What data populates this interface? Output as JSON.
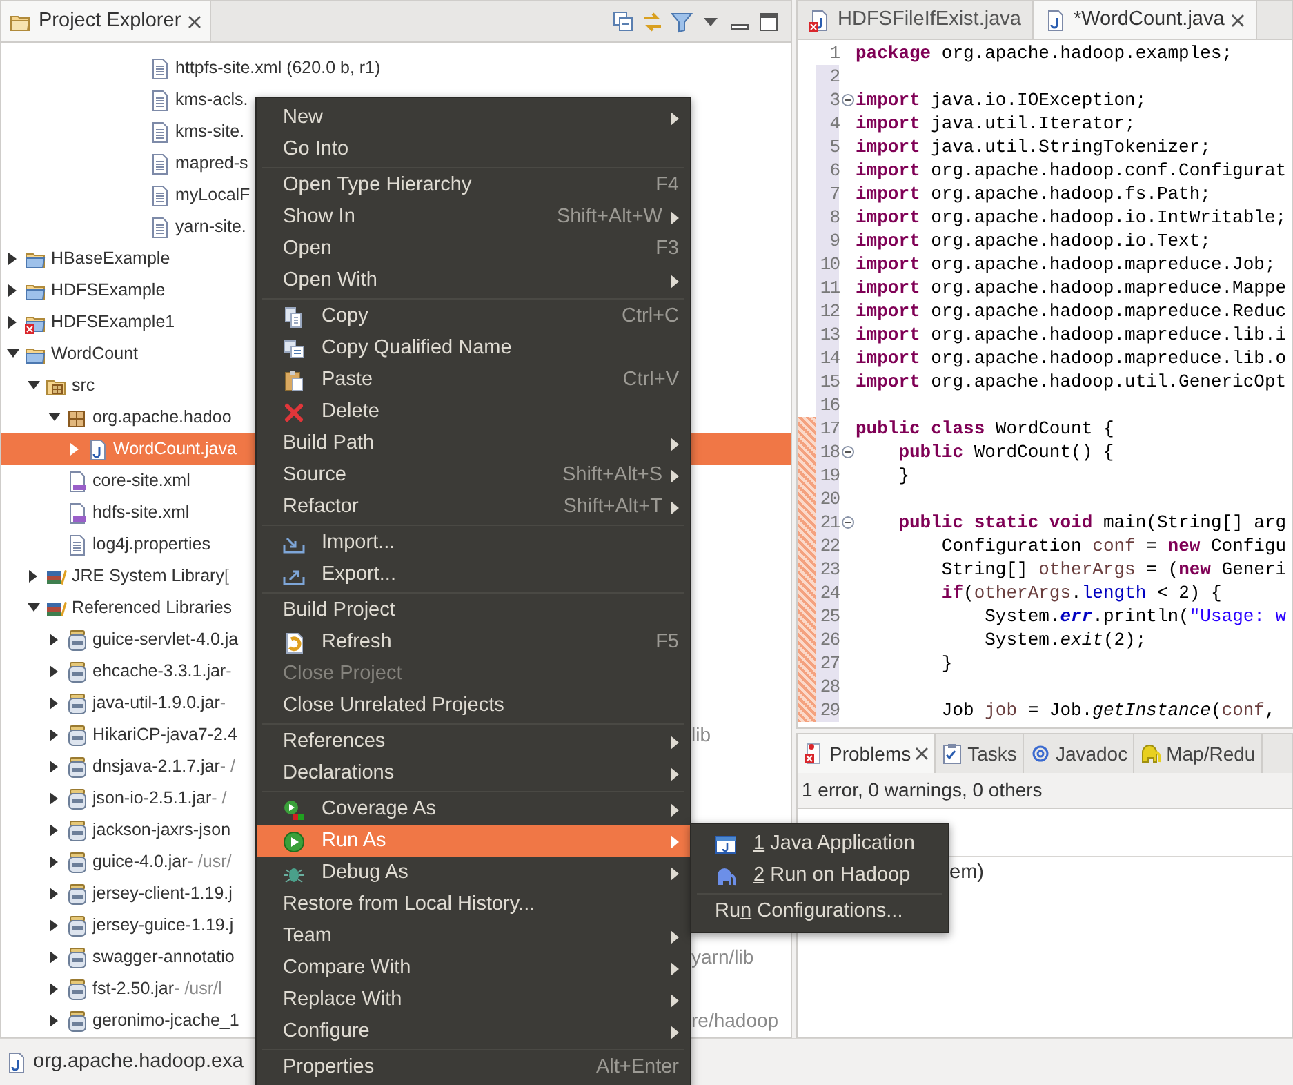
{
  "explorer": {
    "title": "Project Explorer",
    "scrolled_children": [
      {
        "label": "httpfs-site.xml (620.0 b, r1)",
        "kind": "file",
        "selected": false
      },
      {
        "label": "kms-acls.",
        "kind": "file",
        "selected": false
      },
      {
        "label": "kms-site.",
        "kind": "file",
        "selected": false
      },
      {
        "label": "mapred-s",
        "kind": "file",
        "selected": false
      },
      {
        "label": "myLocalF",
        "kind": "file",
        "selected": false
      },
      {
        "label": "yarn-site.",
        "kind": "file",
        "selected": false
      }
    ],
    "items": [
      {
        "label": "HBaseExample",
        "kind": "project",
        "expanded": false,
        "selected": false
      },
      {
        "label": "HDFSExample",
        "kind": "project",
        "expanded": false,
        "selected": false
      },
      {
        "label": "HDFSExample1",
        "kind": "project-error",
        "expanded": false,
        "selected": false
      },
      {
        "label": "WordCount",
        "kind": "project",
        "expanded": true,
        "selected": false,
        "children": [
          {
            "label": "src",
            "kind": "source-folder",
            "expanded": true,
            "selected": false,
            "children": [
              {
                "label": "org.apache.hadoo",
                "kind": "package",
                "expanded": true,
                "selected": false,
                "children": [
                  {
                    "label": "WordCount.java",
                    "kind": "java",
                    "expanded": false,
                    "selected": true
                  }
                ]
              },
              {
                "label": "core-site.xml",
                "kind": "xml",
                "selected": false
              },
              {
                "label": "hdfs-site.xml",
                "kind": "xml",
                "selected": false
              },
              {
                "label": "log4j.properties",
                "kind": "file",
                "selected": false
              }
            ]
          },
          {
            "label": "JRE System Library",
            "detail": " [",
            "kind": "library",
            "expanded": false,
            "selected": false
          },
          {
            "label": "Referenced Libraries",
            "kind": "library",
            "expanded": true,
            "selected": false,
            "children": [
              {
                "label": "guice-servlet-4.0.ja",
                "kind": "jar",
                "expanded": false,
                "selected": false
              },
              {
                "label": "ehcache-3.3.1.jar",
                "detail": " -",
                "kind": "jar",
                "expanded": false,
                "selected": false
              },
              {
                "label": "java-util-1.9.0.jar",
                "detail": " -",
                "kind": "jar",
                "expanded": false,
                "selected": false
              },
              {
                "label": "HikariCP-java7-2.4",
                "tail": "lib",
                "kind": "jar",
                "expanded": false,
                "selected": false
              },
              {
                "label": "dnsjava-2.1.7.jar",
                "detail": " - /",
                "kind": "jar",
                "expanded": false,
                "selected": false
              },
              {
                "label": "json-io-2.5.1.jar",
                "detail": " - /",
                "kind": "jar",
                "expanded": false,
                "selected": false
              },
              {
                "label": "jackson-jaxrs-json",
                "kind": "jar",
                "expanded": false,
                "selected": false
              },
              {
                "label": "guice-4.0.jar",
                "detail": " - /usr/",
                "kind": "jar",
                "expanded": false,
                "selected": false
              },
              {
                "label": "jersey-client-1.19.j",
                "kind": "jar",
                "expanded": false,
                "selected": false
              },
              {
                "label": "jersey-guice-1.19.j",
                "kind": "jar",
                "expanded": false,
                "selected": false
              },
              {
                "label": "swagger-annotatio",
                "tail": "yarn/lib",
                "kind": "jar",
                "expanded": false,
                "selected": false
              },
              {
                "label": "fst-2.50.jar",
                "detail": " - /usr/l",
                "kind": "jar",
                "expanded": false,
                "selected": false
              },
              {
                "label": "geronimo-jcache_1",
                "tail": "re/hadoop",
                "kind": "jar",
                "expanded": false,
                "selected": false
              }
            ]
          }
        ]
      }
    ]
  },
  "editor": {
    "tabs": [
      {
        "label": "HDFSFileIfExist.java",
        "kind": "java-error",
        "selected": false,
        "closable": false
      },
      {
        "label": "*WordCount.java",
        "kind": "java",
        "selected": true,
        "closable": true
      }
    ],
    "lines": [
      {
        "number": "1",
        "changed": false,
        "flagged": false,
        "fold": false,
        "tokens": [
          {
            "kind": "kw",
            "text": "package"
          },
          {
            "kind": "pl",
            "text": " org.apache.hadoop.examples;"
          }
        ]
      },
      {
        "number": "2",
        "changed": true,
        "flagged": false,
        "fold": false
      },
      {
        "number": "3",
        "changed": true,
        "flagged": false,
        "fold": true,
        "tokens": [
          {
            "kind": "kw",
            "text": "import"
          },
          {
            "kind": "pl",
            "text": " java.io.IOException;"
          }
        ]
      },
      {
        "number": "4",
        "changed": true,
        "flagged": false,
        "fold": false,
        "tokens": [
          {
            "kind": "kw",
            "text": "import"
          },
          {
            "kind": "pl",
            "text": " java.util.Iterator;"
          }
        ]
      },
      {
        "number": "5",
        "changed": true,
        "flagged": false,
        "fold": false,
        "tokens": [
          {
            "kind": "kw",
            "text": "import"
          },
          {
            "kind": "pl",
            "text": " java.util.StringTokenizer;"
          }
        ]
      },
      {
        "number": "6",
        "changed": true,
        "flagged": false,
        "fold": false,
        "tokens": [
          {
            "kind": "kw",
            "text": "import"
          },
          {
            "kind": "pl",
            "text": " org.apache.hadoop.conf.Configurat"
          }
        ]
      },
      {
        "number": "7",
        "changed": true,
        "flagged": false,
        "fold": false,
        "tokens": [
          {
            "kind": "kw",
            "text": "import"
          },
          {
            "kind": "pl",
            "text": " org.apache.hadoop.fs.Path;"
          }
        ]
      },
      {
        "number": "8",
        "changed": true,
        "flagged": false,
        "fold": false,
        "tokens": [
          {
            "kind": "kw",
            "text": "import"
          },
          {
            "kind": "pl",
            "text": " org.apache.hadoop.io.IntWritable;"
          }
        ]
      },
      {
        "number": "9",
        "changed": true,
        "flagged": false,
        "fold": false,
        "tokens": [
          {
            "kind": "kw",
            "text": "import"
          },
          {
            "kind": "pl",
            "text": " org.apache.hadoop.io.Text;"
          }
        ]
      },
      {
        "number": "10",
        "changed": true,
        "flagged": false,
        "fold": false,
        "tokens": [
          {
            "kind": "kw",
            "text": "import"
          },
          {
            "kind": "pl",
            "text": " org.apache.hadoop.mapreduce.Job;"
          }
        ]
      },
      {
        "number": "11",
        "changed": true,
        "flagged": false,
        "fold": false,
        "tokens": [
          {
            "kind": "kw",
            "text": "import"
          },
          {
            "kind": "pl",
            "text": " org.apache.hadoop.mapreduce.Mappe"
          }
        ]
      },
      {
        "number": "12",
        "changed": true,
        "flagged": false,
        "fold": false,
        "tokens": [
          {
            "kind": "kw",
            "text": "import"
          },
          {
            "kind": "pl",
            "text": " org.apache.hadoop.mapreduce.Reduc"
          }
        ]
      },
      {
        "number": "13",
        "changed": true,
        "flagged": false,
        "fold": false,
        "tokens": [
          {
            "kind": "kw",
            "text": "import"
          },
          {
            "kind": "pl",
            "text": " org.apache.hadoop.mapreduce.lib.i"
          }
        ]
      },
      {
        "number": "14",
        "changed": true,
        "flagged": false,
        "fold": false,
        "tokens": [
          {
            "kind": "kw",
            "text": "import"
          },
          {
            "kind": "pl",
            "text": " org.apache.hadoop.mapreduce.lib.o"
          }
        ]
      },
      {
        "number": "15",
        "changed": true,
        "flagged": false,
        "fold": false,
        "tokens": [
          {
            "kind": "kw",
            "text": "import"
          },
          {
            "kind": "pl",
            "text": " org.apache.hadoop.util.GenericOpt"
          }
        ]
      },
      {
        "number": "16",
        "changed": true,
        "flagged": false,
        "fold": false
      },
      {
        "number": "17",
        "changed": true,
        "flagged": true,
        "fold": false,
        "tokens": [
          {
            "kind": "kw",
            "text": "public"
          },
          {
            "kind": "kw",
            "text": " class"
          },
          {
            "kind": "pl",
            "text": " WordCount {"
          }
        ]
      },
      {
        "number": "18",
        "changed": true,
        "flagged": true,
        "fold": true,
        "tokens": [
          {
            "kind": "kw",
            "text": "    public"
          },
          {
            "kind": "pl",
            "text": " WordCount() {"
          }
        ]
      },
      {
        "number": "19",
        "changed": true,
        "flagged": true,
        "fold": false,
        "tokens": [
          {
            "kind": "pl",
            "text": "    }"
          }
        ]
      },
      {
        "number": "20",
        "changed": true,
        "flagged": true,
        "fold": false
      },
      {
        "number": "21",
        "changed": true,
        "flagged": true,
        "fold": true,
        "tokens": [
          {
            "kind": "kw",
            "text": "    public"
          },
          {
            "kind": "kw",
            "text": " static"
          },
          {
            "kind": "kw",
            "text": " void"
          },
          {
            "kind": "pl",
            "text": " main(String[] arg"
          }
        ]
      },
      {
        "number": "22",
        "changed": true,
        "flagged": true,
        "fold": false,
        "tokens": [
          {
            "kind": "pl",
            "text": "        Configuration "
          },
          {
            "kind": "var",
            "text": "conf"
          },
          {
            "kind": "pl",
            "text": " = "
          },
          {
            "kind": "kw",
            "text": "new"
          },
          {
            "kind": "pl",
            "text": " Configu"
          }
        ]
      },
      {
        "number": "23",
        "changed": true,
        "flagged": true,
        "fold": false,
        "tokens": [
          {
            "kind": "pl",
            "text": "        String[] "
          },
          {
            "kind": "var",
            "text": "otherArgs"
          },
          {
            "kind": "pl",
            "text": " = ("
          },
          {
            "kind": "kw",
            "text": "new"
          },
          {
            "kind": "pl",
            "text": " Generi"
          }
        ]
      },
      {
        "number": "24",
        "changed": true,
        "flagged": true,
        "fold": false,
        "tokens": [
          {
            "kind": "kw",
            "text": "        if"
          },
          {
            "kind": "pl",
            "text": "("
          },
          {
            "kind": "var",
            "text": "otherArgs"
          },
          {
            "kind": "pl",
            "text": "."
          },
          {
            "kind": "fld",
            "text": "length"
          },
          {
            "kind": "pl",
            "text": " < 2) {"
          }
        ]
      },
      {
        "number": "25",
        "changed": true,
        "flagged": true,
        "fold": false,
        "tokens": [
          {
            "kind": "pl",
            "text": "            System."
          },
          {
            "kind": "sfld",
            "text": "err"
          },
          {
            "kind": "pl",
            "text": ".println("
          },
          {
            "kind": "str",
            "text": "\"Usage: w"
          }
        ]
      },
      {
        "number": "26",
        "changed": true,
        "flagged": true,
        "fold": false,
        "tokens": [
          {
            "kind": "pl",
            "text": "            System."
          },
          {
            "kind": "sm",
            "text": "exit"
          },
          {
            "kind": "pl",
            "text": "(2);"
          }
        ]
      },
      {
        "number": "27",
        "changed": true,
        "flagged": true,
        "fold": false,
        "tokens": [
          {
            "kind": "pl",
            "text": "        }"
          }
        ]
      },
      {
        "number": "28",
        "changed": true,
        "flagged": true,
        "fold": false
      },
      {
        "number": "29",
        "changed": true,
        "flagged": true,
        "fold": false,
        "tokens": [
          {
            "kind": "pl",
            "text": "        Job "
          },
          {
            "kind": "var",
            "text": "job"
          },
          {
            "kind": "pl",
            "text": " = Job."
          },
          {
            "kind": "sm",
            "text": "getInstance"
          },
          {
            "kind": "pl",
            "text": "("
          },
          {
            "kind": "var",
            "text": "conf"
          },
          {
            "kind": "pl",
            "text": ","
          }
        ]
      }
    ]
  },
  "problems": {
    "tabs": [
      {
        "label": "Problems",
        "kind": "problems",
        "selected": true,
        "closable": true
      },
      {
        "label": "Tasks",
        "kind": "tasks",
        "selected": false,
        "closable": false
      },
      {
        "label": "Javadoc",
        "kind": "javadoc",
        "selected": false,
        "closable": false
      },
      {
        "label": "Map/Redu",
        "kind": "mapreduce",
        "selected": false,
        "closable": false
      }
    ],
    "summary": "1 error, 0 warnings, 0 others",
    "row_fragment": "em)"
  },
  "status_bar": {
    "text": "org.apache.hadoop.exa",
    "kind": "java"
  },
  "context_menu": {
    "items": [
      {
        "kind": "plain",
        "label": "New",
        "submenu": true,
        "disabled": false,
        "selected": false
      },
      {
        "kind": "plain",
        "label": "Go Into",
        "submenu": false,
        "disabled": false,
        "selected": false
      },
      {
        "kind": "separator"
      },
      {
        "kind": "plain",
        "label": "Open Type Hierarchy",
        "shortcut": "F4",
        "submenu": false,
        "disabled": false,
        "selected": false
      },
      {
        "kind": "plain",
        "label": "Show In",
        "shortcut": "Shift+Alt+W",
        "submenu": true,
        "disabled": false,
        "selected": false
      },
      {
        "kind": "plain",
        "label": "Open",
        "shortcut": "F3",
        "submenu": false,
        "disabled": false,
        "selected": false
      },
      {
        "kind": "plain",
        "label": "Open With",
        "submenu": true,
        "disabled": false,
        "selected": false
      },
      {
        "kind": "separator"
      },
      {
        "kind": "copy",
        "label": "Copy",
        "shortcut": "Ctrl+C",
        "submenu": false,
        "disabled": false,
        "selected": false
      },
      {
        "kind": "copy-qualified",
        "label": "Copy Qualified Name",
        "submenu": false,
        "disabled": false,
        "selected": false
      },
      {
        "kind": "paste",
        "label": "Paste",
        "shortcut": "Ctrl+V",
        "submenu": false,
        "disabled": false,
        "selected": false
      },
      {
        "kind": "delete",
        "label": "Delete",
        "submenu": false,
        "disabled": false,
        "selected": false
      },
      {
        "kind": "plain",
        "label": "Build Path",
        "submenu": true,
        "disabled": false,
        "selected": false
      },
      {
        "kind": "plain",
        "label": "Source",
        "shortcut": "Shift+Alt+S",
        "submenu": true,
        "disabled": false,
        "selected": false
      },
      {
        "kind": "plain",
        "label": "Refactor",
        "shortcut": "Shift+Alt+T",
        "submenu": true,
        "disabled": false,
        "selected": false
      },
      {
        "kind": "separator"
      },
      {
        "kind": "import",
        "label": "Import...",
        "submenu": false,
        "disabled": false,
        "selected": false
      },
      {
        "kind": "export",
        "label": "Export...",
        "submenu": false,
        "disabled": false,
        "selected": false
      },
      {
        "kind": "separator"
      },
      {
        "kind": "plain",
        "label": "Build Project",
        "submenu": false,
        "disabled": false,
        "selected": false
      },
      {
        "kind": "refresh",
        "label": "Refresh",
        "shortcut": "F5",
        "submenu": false,
        "disabled": false,
        "selected": false
      },
      {
        "kind": "plain",
        "label": "Close Project",
        "submenu": false,
        "disabled": true,
        "selected": false
      },
      {
        "kind": "plain",
        "label": "Close Unrelated Projects",
        "submenu": false,
        "disabled": false,
        "selected": false
      },
      {
        "kind": "separator"
      },
      {
        "kind": "plain",
        "label": "References",
        "submenu": true,
        "disabled": false,
        "selected": false
      },
      {
        "kind": "plain",
        "label": "Declarations",
        "submenu": true,
        "disabled": false,
        "selected": false
      },
      {
        "kind": "separator"
      },
      {
        "kind": "coverage",
        "label": "Coverage As",
        "submenu": true,
        "disabled": false,
        "selected": false
      },
      {
        "kind": "run",
        "label": "Run As",
        "submenu": true,
        "disabled": false,
        "selected": true
      },
      {
        "kind": "debug",
        "label": "Debug As",
        "submenu": true,
        "disabled": false,
        "selected": false
      },
      {
        "kind": "plain",
        "label": "Restore from Local History...",
        "submenu": false,
        "disabled": false,
        "selected": false
      },
      {
        "kind": "plain",
        "label": "Team",
        "submenu": true,
        "disabled": false,
        "selected": false
      },
      {
        "kind": "plain",
        "label": "Compare With",
        "submenu": true,
        "disabled": false,
        "selected": false
      },
      {
        "kind": "plain",
        "label": "Replace With",
        "submenu": true,
        "disabled": false,
        "selected": false
      },
      {
        "kind": "plain",
        "label": "Configure",
        "submenu": true,
        "disabled": false,
        "selected": false
      },
      {
        "kind": "separator"
      },
      {
        "kind": "plain",
        "label": "Properties",
        "shortcut": "Alt+Enter",
        "submenu": false,
        "disabled": false,
        "selected": false
      }
    ]
  },
  "run_as_submenu": {
    "items": [
      {
        "kind": "java-app",
        "mnemonic": "1",
        "suffix": " Java Application"
      },
      {
        "kind": "elephant",
        "mnemonic": "2",
        "suffix": " Run on Hadoop"
      },
      {
        "kind": "separator"
      },
      {
        "kind": "plain",
        "prefix": "Ru",
        "mnemonic": "n",
        "suffix": " Configurations..."
      }
    ]
  }
}
